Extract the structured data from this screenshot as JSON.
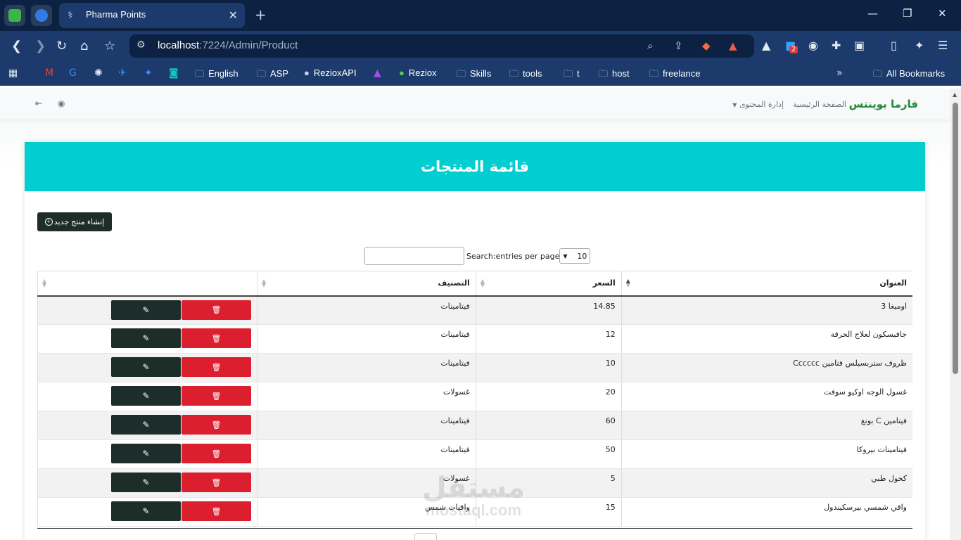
{
  "browser": {
    "tab_title": "Pharma Points",
    "url_host": "localhost",
    "url_path": ":7224/Admin/Product",
    "new_tab_glyph": "+",
    "close_tab_glyph": "✕",
    "extension_badge": "2",
    "bookmarks": [
      "English",
      "ASP",
      "RezioxAPI",
      "Reziox",
      "Skills",
      "tools",
      "t",
      "host",
      "freelance"
    ],
    "all_bookmarks_label": "All Bookmarks"
  },
  "navbar": {
    "brand": "فارما بوينتس",
    "home_link": "الصفحة الرئيسية",
    "content_menu": "إدارة المحتوى"
  },
  "page": {
    "title": "قائمة المنتجات",
    "create_button": "إنشاء منتج جديد",
    "search_label": "Search:",
    "entries_label": "entries per page",
    "entries_value": "10"
  },
  "table": {
    "headers": [
      "العنوان",
      "السعر",
      "التصنيف",
      ""
    ],
    "rows": [
      {
        "title": "اوميغا 3",
        "price": "14.85",
        "category": "فيتامينات"
      },
      {
        "title": "جافيسكون لعلاج الحرقة",
        "price": "12",
        "category": "فيتامينات"
      },
      {
        "title": "ظروف ستربسيلس فتامين Cccccc",
        "price": "10",
        "category": "فيتامينات"
      },
      {
        "title": "غسول الوجه اوكيو سوفت",
        "price": "20",
        "category": "غسولات"
      },
      {
        "title": "فيتامين C بونغ",
        "price": "60",
        "category": "فيتامينات"
      },
      {
        "title": "فيتامينات بيروكا",
        "price": "50",
        "category": "فيتامينات"
      },
      {
        "title": "كحول طبي",
        "price": "5",
        "category": "غسولات"
      },
      {
        "title": "واقي شمسي بيرسكيندول",
        "price": "15",
        "category": "واقيات شمس"
      }
    ]
  },
  "watermark": {
    "arabic": "مستقل",
    "latin": "mostaql.com"
  },
  "colors": {
    "header": "#00ced1",
    "delete": "#dc1f2e",
    "dark": "#1c2d2a",
    "brand": "#1f8a3b",
    "chrome": "#1c3a6b"
  }
}
